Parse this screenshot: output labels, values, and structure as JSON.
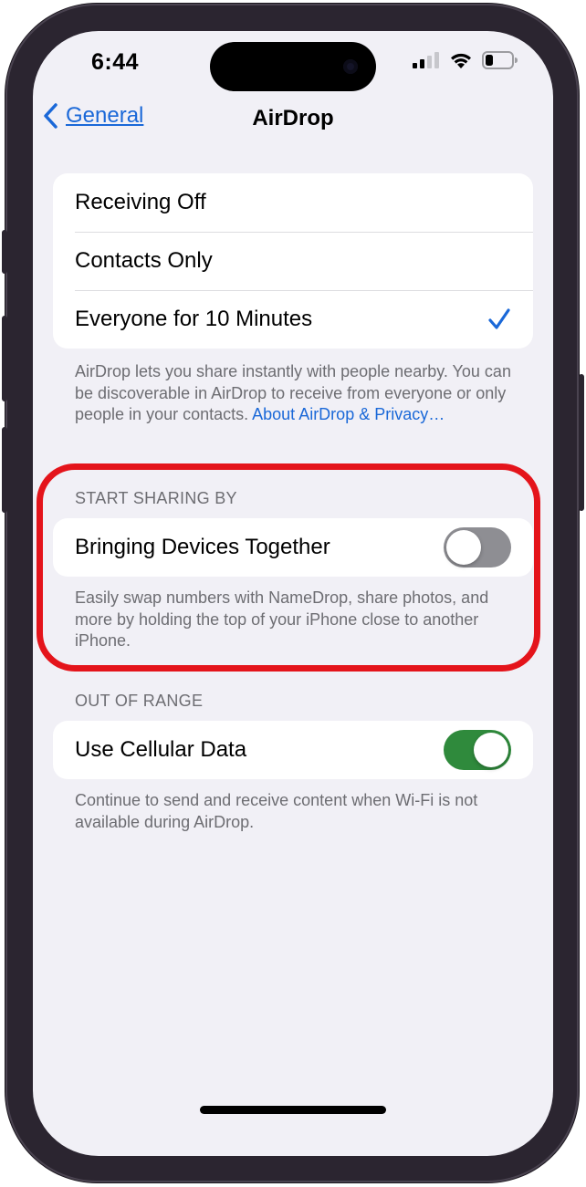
{
  "status_bar": {
    "time": "6:44",
    "icons": [
      "cellular-signal-icon",
      "wifi-icon",
      "battery-icon"
    ]
  },
  "nav": {
    "back_label": "General",
    "title": "AirDrop"
  },
  "receiving": {
    "options": [
      {
        "label": "Receiving Off",
        "selected": false
      },
      {
        "label": "Contacts Only",
        "selected": false
      },
      {
        "label": "Everyone for 10 Minutes",
        "selected": true
      }
    ],
    "footer_text": "AirDrop lets you share instantly with people nearby. You can be discoverable in AirDrop to receive from everyone or only people in your contacts.",
    "footer_link": "About AirDrop & Privacy…"
  },
  "start_sharing": {
    "header": "START SHARING BY",
    "row_label": "Bringing Devices Together",
    "toggle_on": false,
    "footer_text": "Easily swap numbers with NameDrop, share photos, and more by holding the top of your iPhone close to another iPhone."
  },
  "out_of_range": {
    "header": "OUT OF RANGE",
    "row_label": "Use Cellular Data",
    "toggle_on": true,
    "footer_text": "Continue to send and receive content when Wi-Fi is not available during AirDrop."
  },
  "colors": {
    "accent": "#1a68d8",
    "toggle_on": "#2f8a3c",
    "toggle_off": "#8e8e93",
    "highlight": "#e4141b",
    "background": "#f1f0f6"
  }
}
